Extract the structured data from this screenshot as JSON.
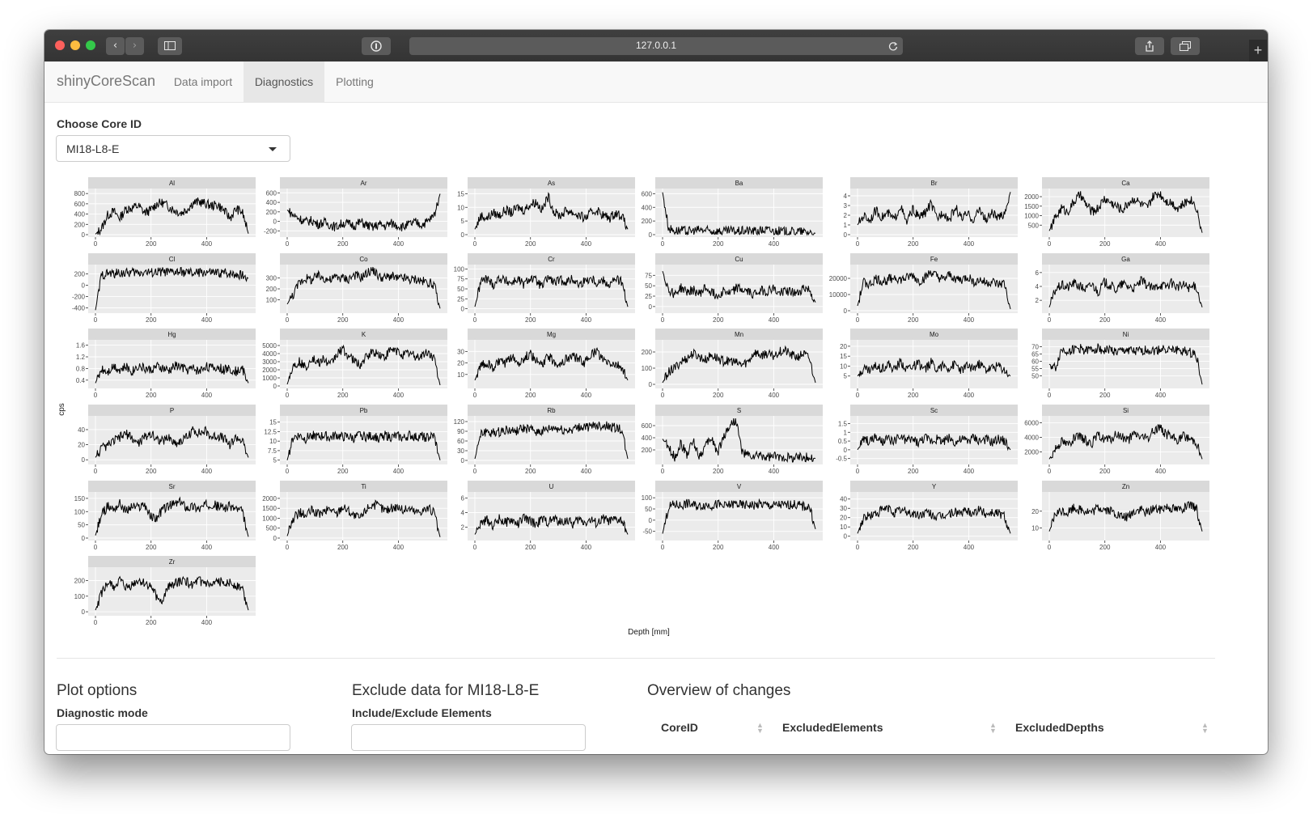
{
  "browser": {
    "url": "127.0.0.1"
  },
  "app": {
    "brand": "shinyCoreScan",
    "tabs": [
      {
        "label": "Data import",
        "active": false
      },
      {
        "label": "Diagnostics",
        "active": true
      },
      {
        "label": "Plotting",
        "active": false
      }
    ]
  },
  "core_select": {
    "label": "Choose Core ID",
    "value": "MI18-L8-E"
  },
  "chart_data": {
    "type": "line",
    "layout": "facet_wrap 6 columns",
    "xlabel": "Depth [mm]",
    "ylabel": "cps",
    "x_ticks": [
      0,
      200,
      400
    ],
    "x_range": [
      0,
      550
    ],
    "panels": [
      {
        "name": "Al",
        "yticks": [
          0,
          200,
          400,
          600,
          800
        ],
        "ylim": [
          0,
          850
        ],
        "profile": [
          10,
          120,
          380,
          450,
          320,
          500,
          520,
          560,
          430,
          470,
          600,
          620,
          540,
          470,
          420,
          500,
          620,
          640,
          600,
          560,
          580,
          470,
          320,
          500,
          440,
          20
        ]
      },
      {
        "name": "Ar",
        "yticks": [
          -200,
          0,
          200,
          400,
          600
        ],
        "ylim": [
          -280,
          640
        ],
        "profile": [
          240,
          130,
          60,
          -10,
          20,
          -60,
          -20,
          -70,
          -120,
          -40,
          -50,
          -90,
          -10,
          -80,
          -130,
          -60,
          -100,
          -40,
          -80,
          -120,
          -60,
          -20,
          -70,
          0,
          120,
          580
        ]
      },
      {
        "name": "As",
        "yticks": [
          0,
          5,
          10,
          15
        ],
        "ylim": [
          0,
          16
        ],
        "profile": [
          2,
          7,
          6,
          8,
          7,
          9,
          8,
          10,
          9,
          11,
          12,
          9,
          14,
          8,
          7,
          9,
          8,
          7,
          6,
          8,
          9,
          7,
          6,
          8,
          7,
          2
        ]
      },
      {
        "name": "Ba",
        "yticks": [
          0,
          200,
          400,
          600
        ],
        "ylim": [
          0,
          640
        ],
        "profile": [
          620,
          90,
          60,
          60,
          50,
          55,
          70,
          60,
          50,
          55,
          40,
          60,
          45,
          55,
          60,
          50,
          60,
          70,
          55,
          50,
          45,
          40,
          50,
          35,
          40,
          20
        ]
      },
      {
        "name": "Br",
        "yticks": [
          0,
          1,
          2,
          3,
          4
        ],
        "ylim": [
          0,
          4.5
        ],
        "profile": [
          1,
          2,
          1.5,
          2.5,
          1.8,
          2.2,
          1.5,
          3,
          1.2,
          2.6,
          1.8,
          2.2,
          3.2,
          1.6,
          2.4,
          1.5,
          2.8,
          1.7,
          2.1,
          1.5,
          2.7,
          1.4,
          2.3,
          1.6,
          2.2,
          4.4
        ]
      },
      {
        "name": "Ca",
        "yticks": [
          500,
          1000,
          1500,
          2000
        ],
        "ylim": [
          0,
          2300
        ],
        "profile": [
          200,
          900,
          1400,
          1200,
          1700,
          2100,
          1600,
          1200,
          1400,
          1900,
          1700,
          1500,
          1300,
          1700,
          1900,
          1600,
          1400,
          2000,
          2200,
          1800,
          1700,
          1400,
          1600,
          1900,
          1500,
          100
        ]
      },
      {
        "name": "Cl",
        "yticks": [
          -400,
          -200,
          0,
          200
        ],
        "ylim": [
          -450,
          320
        ],
        "profile": [
          -440,
          180,
          210,
          200,
          220,
          210,
          230,
          220,
          240,
          220,
          230,
          240,
          220,
          230,
          230,
          220,
          210,
          220,
          230,
          220,
          210,
          220,
          210,
          200,
          180,
          120
        ]
      },
      {
        "name": "Co",
        "yticks": [
          100,
          200,
          300
        ],
        "ylim": [
          0,
          400
        ],
        "profile": [
          60,
          150,
          260,
          300,
          280,
          320,
          300,
          280,
          310,
          300,
          290,
          330,
          300,
          340,
          380,
          310,
          300,
          320,
          290,
          300,
          280,
          290,
          270,
          260,
          240,
          20
        ]
      },
      {
        "name": "Cr",
        "yticks": [
          0,
          25,
          50,
          75,
          100
        ],
        "ylim": [
          -5,
          105
        ],
        "profile": [
          5,
          70,
          75,
          60,
          78,
          70,
          65,
          75,
          60,
          78,
          70,
          55,
          80,
          65,
          72,
          68,
          75,
          60,
          70,
          78,
          65,
          72,
          60,
          75,
          68,
          5
        ]
      },
      {
        "name": "Cu",
        "yticks": [
          0,
          25,
          50,
          75
        ],
        "ylim": [
          -10,
          95
        ],
        "profile": [
          85,
          40,
          30,
          45,
          35,
          40,
          30,
          45,
          35,
          25,
          40,
          30,
          45,
          40,
          35,
          30,
          40,
          35,
          45,
          30,
          40,
          35,
          30,
          45,
          40,
          10
        ]
      },
      {
        "name": "Fe",
        "yticks": [
          0,
          10000,
          20000
        ],
        "ylim": [
          0,
          27000
        ],
        "profile": [
          3000,
          18000,
          16000,
          20000,
          18000,
          19000,
          21000,
          19000,
          20000,
          22000,
          18000,
          20000,
          24000,
          21000,
          19000,
          22000,
          20000,
          19000,
          21000,
          18000,
          19000,
          17000,
          18000,
          16000,
          17000,
          1000
        ]
      },
      {
        "name": "Ga",
        "yticks": [
          2,
          4,
          6
        ],
        "ylim": [
          0.5,
          6.8
        ],
        "profile": [
          1,
          3.5,
          4.2,
          3.8,
          4.5,
          4,
          3.6,
          4.3,
          3.2,
          4.6,
          4.1,
          3.5,
          4.4,
          4,
          3.7,
          4.8,
          4.2,
          3.6,
          4.3,
          4,
          4.5,
          3.9,
          4.2,
          3.8,
          4.1,
          1
        ]
      },
      {
        "name": "Hg",
        "yticks": [
          0.4,
          0.8,
          1.2,
          1.6
        ],
        "ylim": [
          0.2,
          1.7
        ],
        "profile": [
          0.3,
          0.8,
          0.7,
          0.9,
          0.75,
          0.85,
          0.7,
          0.9,
          0.8,
          0.75,
          0.85,
          0.8,
          0.7,
          0.9,
          0.85,
          0.75,
          0.8,
          0.7,
          0.9,
          0.8,
          0.85,
          0.75,
          0.8,
          0.7,
          0.8,
          0.3
        ]
      },
      {
        "name": "K",
        "yticks": [
          0,
          1000,
          2000,
          3000,
          4000,
          5000
        ],
        "ylim": [
          0,
          5400
        ],
        "profile": [
          200,
          2500,
          3000,
          2200,
          3500,
          2800,
          3300,
          2500,
          3800,
          4600,
          3700,
          3000,
          2600,
          3600,
          4200,
          3900,
          3500,
          4500,
          4300,
          3900,
          4100,
          3600,
          3800,
          4200,
          3500,
          100
        ]
      },
      {
        "name": "Mg",
        "yticks": [
          10,
          20,
          30
        ],
        "ylim": [
          0,
          38
        ],
        "profile": [
          5,
          18,
          20,
          15,
          22,
          19,
          25,
          20,
          24,
          28,
          22,
          18,
          26,
          21,
          19,
          24,
          26,
          23,
          20,
          28,
          30,
          22,
          20,
          18,
          16,
          5
        ]
      },
      {
        "name": "Mn",
        "yticks": [
          0,
          100,
          200
        ],
        "ylim": [
          -10,
          260
        ],
        "profile": [
          10,
          80,
          100,
          140,
          160,
          190,
          170,
          150,
          180,
          160,
          140,
          150,
          130,
          120,
          140,
          200,
          180,
          190,
          170,
          200,
          210,
          180,
          170,
          190,
          160,
          10
        ]
      },
      {
        "name": "Mo",
        "yticks": [
          5,
          10,
          15,
          20
        ],
        "ylim": [
          0,
          22
        ],
        "profile": [
          5,
          9,
          8,
          10,
          9,
          11,
          8,
          12,
          9,
          10,
          11,
          8,
          12,
          9,
          10,
          9,
          11,
          8,
          10,
          9,
          11,
          8,
          9,
          10,
          8,
          5
        ]
      },
      {
        "name": "Ni",
        "yticks": [
          50,
          55,
          60,
          65,
          70
        ],
        "ylim": [
          43,
          73
        ],
        "profile": [
          58,
          55,
          68,
          67,
          68,
          69,
          67,
          68,
          69,
          67,
          68,
          66,
          67,
          68,
          66,
          67,
          68,
          67,
          68,
          69,
          67,
          68,
          67,
          66,
          65,
          44
        ]
      },
      {
        "name": "P",
        "yticks": [
          0,
          20,
          40
        ],
        "ylim": [
          -3,
          55
        ],
        "profile": [
          3,
          15,
          18,
          25,
          30,
          35,
          28,
          22,
          30,
          35,
          28,
          25,
          30,
          22,
          25,
          30,
          40,
          35,
          38,
          30,
          32,
          28,
          20,
          30,
          25,
          3
        ]
      },
      {
        "name": "Pb",
        "yticks": [
          5,
          7.5,
          10,
          12.5,
          15
        ],
        "ylim": [
          4.5,
          16
        ],
        "profile": [
          5,
          11,
          11.5,
          10.5,
          11.8,
          11,
          11.5,
          10.8,
          11.6,
          11,
          11.2,
          10.6,
          11.8,
          11,
          11.4,
          10.8,
          11.5,
          11,
          11.3,
          10.7,
          11.6,
          11,
          11.2,
          10.9,
          11.4,
          5
        ]
      },
      {
        "name": "Rb",
        "yticks": [
          0,
          30,
          60,
          90,
          120
        ],
        "ylim": [
          -5,
          130
        ],
        "profile": [
          5,
          80,
          90,
          85,
          88,
          95,
          90,
          92,
          98,
          95,
          90,
          88,
          96,
          100,
          95,
          92,
          98,
          100,
          105,
          102,
          110,
          108,
          104,
          100,
          95,
          5
        ]
      },
      {
        "name": "S",
        "yticks": [
          200,
          400,
          600
        ],
        "ylim": [
          0,
          720
        ],
        "profile": [
          380,
          230,
          80,
          300,
          130,
          350,
          100,
          250,
          400,
          150,
          420,
          600,
          700,
          160,
          100,
          80,
          110,
          70,
          90,
          75,
          85,
          70,
          80,
          90,
          70,
          60
        ]
      },
      {
        "name": "Sc",
        "yticks": [
          -0.5,
          0,
          0.5,
          1,
          1.5
        ],
        "ylim": [
          -0.7,
          1.8
        ],
        "profile": [
          0,
          0.6,
          0.5,
          0.7,
          0.4,
          0.6,
          0.5,
          0.7,
          0.5,
          0.6,
          0.4,
          0.7,
          0.5,
          0.6,
          0.5,
          0.7,
          0.4,
          0.6,
          0.5,
          0.7,
          0.5,
          0.6,
          0.4,
          0.6,
          0.5,
          0
        ]
      },
      {
        "name": "Si",
        "yticks": [
          2000,
          4000,
          6000
        ],
        "ylim": [
          600,
          6600
        ],
        "profile": [
          1000,
          2500,
          3500,
          3000,
          3800,
          4000,
          3500,
          3200,
          4200,
          3800,
          3600,
          4400,
          3900,
          3700,
          4500,
          4100,
          3800,
          4800,
          5500,
          4500,
          4000,
          3600,
          4200,
          3800,
          3500,
          1000
        ]
      },
      {
        "name": "Sr",
        "yticks": [
          0,
          50,
          100,
          150
        ],
        "ylim": [
          0,
          165
        ],
        "profile": [
          10,
          90,
          120,
          110,
          130,
          100,
          120,
          115,
          130,
          80,
          75,
          110,
          120,
          130,
          135,
          115,
          120,
          110,
          125,
          130,
          120,
          115,
          120,
          110,
          100,
          5
        ]
      },
      {
        "name": "Ti",
        "yticks": [
          0,
          500,
          1000,
          1500,
          2000
        ],
        "ylim": [
          0,
          2200
        ],
        "profile": [
          100,
          1000,
          1300,
          1100,
          1400,
          1200,
          1300,
          1500,
          1200,
          1600,
          1400,
          1100,
          1000,
          1500,
          1700,
          1600,
          1400,
          1500,
          1600,
          1400,
          1500,
          1300,
          1400,
          1500,
          1300,
          50
        ]
      },
      {
        "name": "U",
        "yticks": [
          2,
          4,
          6
        ],
        "ylim": [
          0.5,
          6.5
        ],
        "profile": [
          1,
          2.5,
          3,
          2.2,
          3.2,
          2.6,
          3,
          2.4,
          3.3,
          2.8,
          2.5,
          3.1,
          2.7,
          3.2,
          2.6,
          3,
          2.4,
          3.1,
          2.7,
          3,
          2.5,
          3.2,
          2.8,
          3,
          2.9,
          1
        ]
      },
      {
        "name": "V",
        "yticks": [
          -50,
          0,
          50,
          100
        ],
        "ylim": [
          -80,
          115
        ],
        "profile": [
          -60,
          60,
          70,
          65,
          75,
          68,
          62,
          70,
          66,
          72,
          60,
          68,
          74,
          65,
          70,
          66,
          72,
          68,
          64,
          70,
          66,
          72,
          68,
          62,
          60,
          -40
        ]
      },
      {
        "name": "Y",
        "yticks": [
          0,
          10,
          20,
          30,
          40
        ],
        "ylim": [
          -2,
          45
        ],
        "profile": [
          3,
          20,
          22,
          24,
          28,
          30,
          25,
          28,
          26,
          24,
          22,
          25,
          24,
          20,
          22,
          24,
          26,
          25,
          27,
          26,
          28,
          24,
          26,
          25,
          22,
          3
        ]
      },
      {
        "name": "Zn",
        "yticks": [
          10,
          20
        ],
        "ylim": [
          4,
          30
        ],
        "profile": [
          8,
          18,
          20,
          19,
          22,
          21,
          20,
          19,
          22,
          21,
          20,
          18,
          16,
          17,
          20,
          21,
          19,
          22,
          21,
          23,
          22,
          21,
          22,
          23,
          22,
          8
        ]
      },
      {
        "name": "Zr",
        "yticks": [
          0,
          100,
          200
        ],
        "ylim": [
          -10,
          270
        ],
        "profile": [
          10,
          120,
          180,
          160,
          200,
          150,
          170,
          200,
          180,
          160,
          100,
          60,
          170,
          180,
          200,
          190,
          170,
          200,
          180,
          160,
          190,
          200,
          180,
          170,
          150,
          10
        ]
      }
    ]
  },
  "plot_options": {
    "heading": "Plot options",
    "mode_label": "Diagnostic mode"
  },
  "exclude": {
    "heading": "Exclude data for MI18-L8-E",
    "elements_label": "Include/Exclude Elements"
  },
  "overview": {
    "heading": "Overview of changes",
    "columns": [
      "CoreID",
      "ExcludedElements",
      "ExcludedDepths"
    ]
  }
}
